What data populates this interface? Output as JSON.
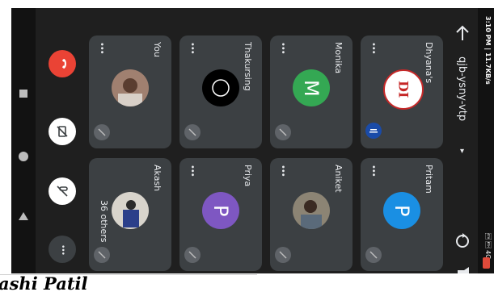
{
  "status": {
    "time": "3:10 PM | 11.7KB/s",
    "right": "\u0002 \u0003 4G"
  },
  "meeting": {
    "code": "qjb-ysny-vtp"
  },
  "participants": [
    {
      "name": "Dhyana's",
      "initial": "DI"
    },
    {
      "name": "Monika",
      "initial": "M"
    },
    {
      "name": "Thakursing",
      "initial": ""
    },
    {
      "name": "You",
      "initial": ""
    },
    {
      "name": "Pritam",
      "initial": "P"
    },
    {
      "name": "Aniket",
      "initial": ""
    },
    {
      "name": "Priya",
      "initial": "P"
    },
    {
      "name": "Akash",
      "initial": "",
      "others": "36 others"
    }
  ],
  "colors": {
    "monika": "#34a853",
    "pritam": "#1a8fe3",
    "priya": "#7e57c2",
    "end": "#ea4335"
  },
  "more_label": "•••",
  "caption": {
    "text": "ashi Patil"
  }
}
